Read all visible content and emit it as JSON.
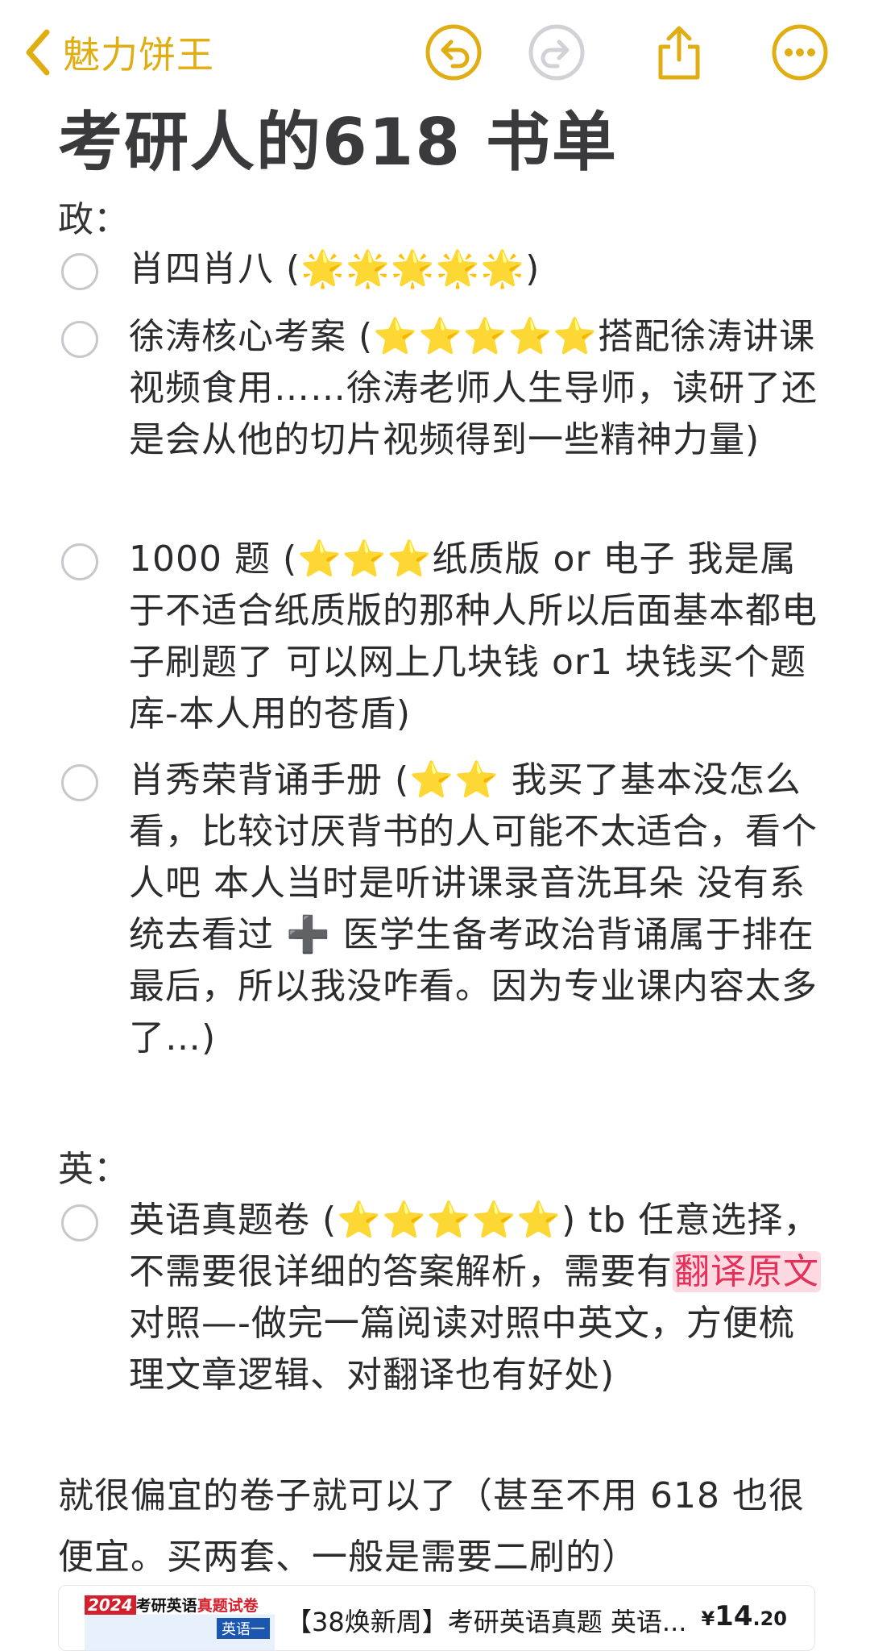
{
  "topbar": {
    "back_label": "魅力饼王",
    "icons": [
      "chevron-left-icon",
      "undo-icon",
      "redo-icon",
      "share-icon",
      "more-icon"
    ],
    "accent_color": "#e0ad13"
  },
  "note": {
    "title": "考研人的618 书单",
    "section_politics": "政：",
    "politics_items": [
      {
        "name": "肖四肖八",
        "open": " (",
        "stars": "🌟🌟🌟🌟🌟",
        "text": ")"
      },
      {
        "name": "徐涛核心考案",
        "open": " (",
        "stars": "⭐⭐⭐⭐⭐",
        "text": "搭配徐涛讲课视频食用……徐涛老师人生导师，读研了还是会从他的切片视频得到一些精神力量)"
      },
      {
        "name": "1000 题",
        "open": " (",
        "stars": "⭐⭐⭐",
        "text": "纸质版 or 电子 我是属于不适合纸质版的那种人所以后面基本都电子刷题了 可以网上几块钱 or1 块钱买个题库-本人用的苍盾)"
      },
      {
        "name": "肖秀荣背诵手册",
        "open": " (",
        "stars": "⭐⭐",
        "text": " 我买了基本没怎么看，比较讨厌背书的人可能不太适合，看个人吧 本人当时是听讲课录音洗耳朵 没有系统去看过 ➕ 医学生备考政治背诵属于排在最后，所以我没咋看。因为专业课内容太多了…)"
      }
    ],
    "section_english": "英：",
    "english_item": {
      "name": "英语真题卷",
      "open": " (",
      "stars": "⭐⭐⭐⭐⭐",
      "text_before": ") tb 任意选择，不需要很详细的答案解析，需要有",
      "highlight": "翻译原文",
      "text_after": "对照—-做完一篇阅读对照中英文，方便梳理文章逻辑、对翻译也有好处)"
    },
    "footer_text": "就很偏宜的卷子就可以了（甚至不用 618 也很便宜。买两套、一般是需要二刷的）"
  },
  "product_card": {
    "thumb_badge": "2024",
    "thumb_title_black": "考研英语",
    "thumb_title_red": "真题试卷",
    "thumb_sub": "英语一",
    "title": "【38焕新周】考研英语真题 英语...",
    "price_symbol": "¥",
    "price_int": "14",
    "price_dec": ".20"
  }
}
